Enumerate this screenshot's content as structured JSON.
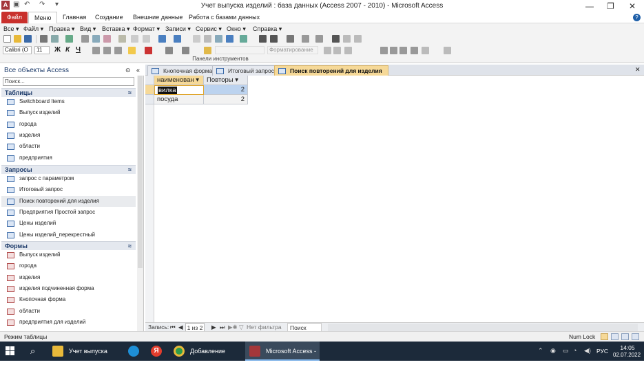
{
  "window": {
    "title": "Учет выпуска изделий : база данных (Access 2007 - 2010)  -  Microsoft Access",
    "app_icon_letter": "A",
    "controls": {
      "minimize": "—",
      "restore": "❐",
      "close": "✕"
    }
  },
  "ribbon_tabs": [
    "Файл",
    "Меню",
    "Главная",
    "Создание",
    "Внешние данные",
    "Работа с базами данных"
  ],
  "menu_bar": [
    "Все ▾",
    "Файл ▾",
    "Правка ▾",
    "Вид ▾",
    "Вставка ▾",
    "Формат ▾",
    "Записи ▾",
    "Сервис ▾",
    "Окно ▾",
    "Справка ▾"
  ],
  "toolbar": {
    "font_name": "Calibri (О",
    "font_size": "11",
    "format_combo": "Форматирование",
    "group_label": "Панели инструментов",
    "bold": "Ж",
    "italic": "К",
    "underline": "Ч"
  },
  "nav_pane": {
    "header": "Все объекты Access",
    "search_placeholder": "Поиск...",
    "sections": [
      {
        "title": "Таблицы",
        "items": [
          "Switchboard Items",
          "Выпуск изделий",
          "города",
          "изделия",
          "области",
          "предприятия"
        ]
      },
      {
        "title": "Запросы",
        "items": [
          "запрос  с параметром",
          "Итоговый запрос",
          "Поиск повторений для изделия",
          "Предприятия Простой запрос",
          "Цены изделий",
          "Цены изделий_перекрестный"
        ]
      },
      {
        "title": "Формы",
        "items": [
          "Выпуск изделий",
          "города",
          "изделия",
          "изделия подчиненная форма",
          "Кнопочная форма",
          "области",
          "предприятия для изделий"
        ]
      }
    ]
  },
  "document_tabs": [
    "Кнопочная форма",
    "Итоговый запрос",
    "Поиск повторений для изделия"
  ],
  "datasheet": {
    "columns": [
      "наименован ▾",
      "Повторы ▾"
    ],
    "rows": [
      [
        "вилка",
        "2"
      ],
      [
        "посуда",
        "2"
      ]
    ]
  },
  "record_nav": {
    "label": "Запись:",
    "position": "1 из 2",
    "filter": "Нет фильтра",
    "search": "Поиск"
  },
  "status_bar": {
    "left": "Режим таблицы",
    "numlock": "Num Lock"
  },
  "taskbar": {
    "buttons": [
      "Учет выпуска изде...",
      "Добавление работ...",
      "Microsoft Access - ..."
    ],
    "lang": "РУС",
    "time": "14:05",
    "date": "02.07.2022"
  },
  "colors": {
    "file_tab": "#c9302c",
    "active_doc_tab": "#f6d998",
    "taskbar": "#1c2a3a",
    "nav_section": "#e4e8ef"
  }
}
